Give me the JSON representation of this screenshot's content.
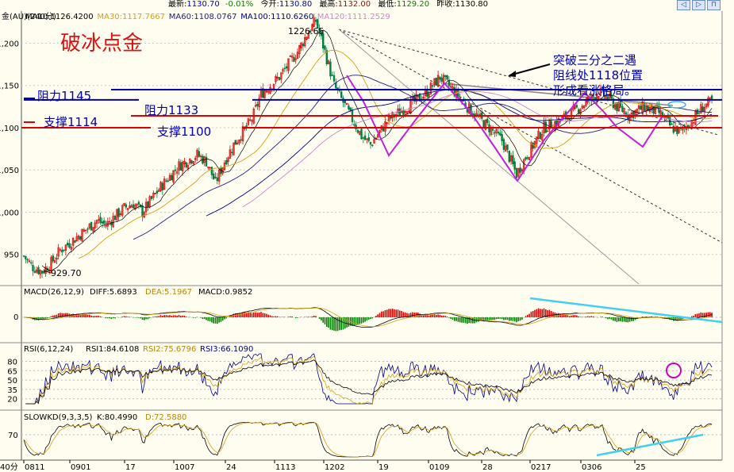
{
  "quote_bar": {
    "last_label": "最新:",
    "last_value": "1130.70",
    "change_value": "-0.01%",
    "open_label": "今开:",
    "open_value": "1130.80",
    "high_label": "最高:",
    "high_value": "1132.00",
    "low_label": "最低:",
    "low_value": "1129.20",
    "prev_label": "昨收:",
    "prev_value": "1130.80"
  },
  "nav_buttons": [
    "◁",
    "▷",
    "⊓"
  ],
  "ma_bar": {
    "symbol": "金(AU)(240分)",
    "items": [
      {
        "label": "MA10:1126.4200",
        "color": "#000000"
      },
      {
        "label": "MA30:1117.7667",
        "color": "#d4a017"
      },
      {
        "label": "MA60:1108.0767",
        "color": "#202080"
      },
      {
        "label": "MA100:1110.6260",
        "color": "#000080"
      },
      {
        "label": "MA120:1111.2529",
        "color": "#cc88cc"
      }
    ]
  },
  "title": "破冰点金",
  "price_axis": {
    "ticks": [
      {
        "label": "1,200",
        "v": 1200
      },
      {
        "label": "1,150",
        "v": 1150
      },
      {
        "label": "1,100",
        "v": 1100
      },
      {
        "label": "1,050",
        "v": 1050
      },
      {
        "label": "1,000",
        "v": 1000
      },
      {
        "label": "950",
        "v": 950
      }
    ],
    "range": [
      915,
      1238
    ]
  },
  "level_labels": {
    "resistance_1145": "阻力1145",
    "resistance_1133": "阻力1133",
    "support_1114": "支撑1114",
    "support_1100": "支撑1100"
  },
  "levels": [
    {
      "name": "resistance-1145",
      "value": 1145,
      "color": "#0000aa"
    },
    {
      "name": "resistance-1133",
      "value": 1133,
      "color": "#0000aa"
    },
    {
      "name": "support-1114",
      "value": 1114,
      "color": "#dd0000"
    },
    {
      "name": "support-1100",
      "value": 1100,
      "color": "#dd0000"
    }
  ],
  "annotations": {
    "high": "1226.65",
    "low": "929.70",
    "note_lines": [
      "突破三分之二遇",
      "阻线处1118位置",
      "形成看涨格局。"
    ]
  },
  "macd": {
    "label": "MACD(26,12,9)",
    "diff": "DIFF:5.6893",
    "dea": "DEA:5.1967",
    "macd": "MACD:0.9852",
    "zero_label": "0"
  },
  "rsi": {
    "label": "RSI(6,12,24)",
    "rsi1": "RSI1:84.6108",
    "rsi2": "RSI2:75.6796",
    "rsi3": "RSI3:66.1090",
    "ticks": [
      "80",
      "65",
      "50",
      "35",
      "20"
    ]
  },
  "kd": {
    "label": "SLOWKD(9,3,3,5)",
    "k": "K:80.4990",
    "d": "D:72.5880",
    "tick": "70"
  },
  "x_axis": {
    "corner": "40分",
    "labels": [
      "0811",
      "0901",
      "17",
      "1007",
      "24",
      "1113",
      "1202",
      "19",
      "0109",
      "28",
      "0217",
      "0306",
      "25"
    ]
  },
  "chart_data": {
    "type": "candlestick",
    "title": "破冰点金",
    "interval": "240分",
    "ylim": [
      915,
      1238
    ],
    "price_path": [
      [
        0,
        948
      ],
      [
        5,
        935
      ],
      [
        10,
        929.7
      ],
      [
        15,
        940
      ],
      [
        20,
        955
      ],
      [
        30,
        972
      ],
      [
        40,
        990
      ],
      [
        45,
        985
      ],
      [
        55,
        1005
      ],
      [
        60,
        1010
      ],
      [
        65,
        1000
      ],
      [
        75,
        1030
      ],
      [
        85,
        1055
      ],
      [
        95,
        1068
      ],
      [
        100,
        1060
      ],
      [
        105,
        1035
      ],
      [
        110,
        1060
      ],
      [
        115,
        1080
      ],
      [
        125,
        1110
      ],
      [
        130,
        1140
      ],
      [
        140,
        1160
      ],
      [
        150,
        1190
      ],
      [
        155,
        1210
      ],
      [
        160,
        1226.65
      ],
      [
        165,
        1190
      ],
      [
        170,
        1150
      ],
      [
        175,
        1130
      ],
      [
        180,
        1110
      ],
      [
        185,
        1090
      ],
      [
        190,
        1080
      ],
      [
        200,
        1110
      ],
      [
        210,
        1125
      ],
      [
        220,
        1140
      ],
      [
        228,
        1160
      ],
      [
        235,
        1145
      ],
      [
        245,
        1120
      ],
      [
        255,
        1100
      ],
      [
        262,
        1085
      ],
      [
        270,
        1045
      ],
      [
        275,
        1065
      ],
      [
        285,
        1100
      ],
      [
        295,
        1110
      ],
      [
        305,
        1125
      ],
      [
        315,
        1142
      ],
      [
        320,
        1135
      ],
      [
        325,
        1125
      ],
      [
        332,
        1115
      ],
      [
        340,
        1125
      ],
      [
        348,
        1118
      ],
      [
        355,
        1100
      ],
      [
        360,
        1095
      ],
      [
        366,
        1108
      ],
      [
        372,
        1125
      ],
      [
        377,
        1130.7
      ]
    ],
    "levels": [
      1145,
      1133,
      1114,
      1100
    ],
    "macd_summary": {
      "DIFF": 5.6893,
      "DEA": 5.1967,
      "MACD": 0.9852
    },
    "rsi_summary": {
      "RSI1": 84.6108,
      "RSI2": 75.6796,
      "RSI3": 66.109
    },
    "kd_summary": {
      "K": 80.499,
      "D": 72.588
    }
  }
}
